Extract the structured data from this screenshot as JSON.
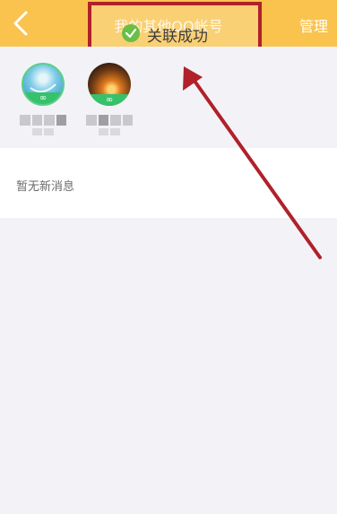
{
  "header": {
    "back_icon": "chevron-left-icon",
    "title": "我的其他QQ帐号",
    "manage_label": "管理",
    "background_color": "#f9c34e"
  },
  "toast": {
    "icon": "check-circle-icon",
    "message": "关联成功",
    "check_color": "#6abf46"
  },
  "annotation": {
    "highlight_color": "#b0212a"
  },
  "accounts": [
    {
      "badge": "∞"
    },
    {
      "badge": "∞"
    }
  ],
  "messages": {
    "empty_text": "暂无新消息"
  }
}
